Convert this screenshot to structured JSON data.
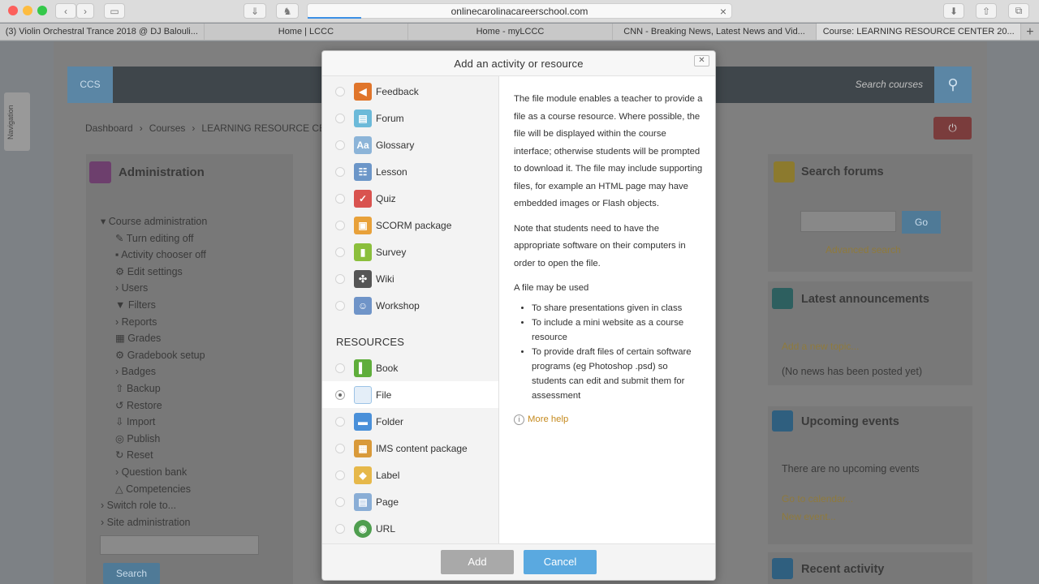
{
  "browser": {
    "url": "onlinecarolinacareerschool.com",
    "tabs": [
      {
        "label": "(3) Violin Orchestral Trance 2018 @ DJ Balouli..."
      },
      {
        "label": "Home | LCCC"
      },
      {
        "label": "Home - myLCCC"
      },
      {
        "label": "CNN - Breaking News, Latest News and Vid..."
      },
      {
        "label": "Course: LEARNING RESOURCE CENTER 20..."
      }
    ]
  },
  "background": {
    "logo": "CCS",
    "search_placeholder": "Search courses",
    "breadcrumb": [
      "Dashboard",
      "Courses",
      "LEARNING RESOURCE CENTER"
    ],
    "nav_tab": "Navigation",
    "admin": {
      "title": "Administration",
      "items": [
        "Course administration",
        "Turn editing off",
        "Activity chooser off",
        "Edit settings",
        "Users",
        "Filters",
        "Reports",
        "Grades",
        "Gradebook setup",
        "Badges",
        "Backup",
        "Restore",
        "Import",
        "Publish",
        "Reset",
        "Question bank",
        "Competencies",
        "Switch role to...",
        "Site administration"
      ],
      "search_button": "Search"
    },
    "search_forums": {
      "title": "Search forums",
      "go": "Go",
      "advanced": "Advanced search"
    },
    "announcements": {
      "title": "Latest announcements",
      "add": "Add a new topic...",
      "empty": "(No news has been posted yet)"
    },
    "events": {
      "title": "Upcoming events",
      "empty": "There are no upcoming events",
      "calendar": "Go to calendar...",
      "new": "New event..."
    },
    "recent": {
      "title": "Recent activity"
    }
  },
  "modal": {
    "title": "Add an activity or resource",
    "close": "✕",
    "activities": [
      {
        "label": "Feedback",
        "icon": "megaphone-icon",
        "color": "#e0752b"
      },
      {
        "label": "Forum",
        "icon": "forum-icon",
        "color": "#6cbad9"
      },
      {
        "label": "Glossary",
        "icon": "glossary-icon",
        "color": "#8cb4d8"
      },
      {
        "label": "Lesson",
        "icon": "lesson-icon",
        "color": "#6c96c8"
      },
      {
        "label": "Quiz",
        "icon": "quiz-icon",
        "color": "#d9534f"
      },
      {
        "label": "SCORM package",
        "icon": "scorm-icon",
        "color": "#e8a13a"
      },
      {
        "label": "Survey",
        "icon": "survey-icon",
        "color": "#8bbf3c"
      },
      {
        "label": "Wiki",
        "icon": "wiki-icon",
        "color": "#555555"
      },
      {
        "label": "Workshop",
        "icon": "workshop-icon",
        "color": "#6f94c8"
      }
    ],
    "resources_heading": "RESOURCES",
    "resources": [
      {
        "label": "Book",
        "icon": "book-icon",
        "color": "#5fae3b"
      },
      {
        "label": "File",
        "icon": "file-icon",
        "color": "#9cc3e6"
      },
      {
        "label": "Folder",
        "icon": "folder-icon",
        "color": "#4a90d9"
      },
      {
        "label": "IMS content package",
        "icon": "ims-package-icon",
        "color": "#d99a3a"
      },
      {
        "label": "Label",
        "icon": "label-icon",
        "color": "#e6b84a"
      },
      {
        "label": "Page",
        "icon": "page-icon",
        "color": "#8aaed6"
      },
      {
        "label": "URL",
        "icon": "url-globe-icon",
        "color": "#4f9e4f"
      }
    ],
    "selected": "File",
    "description": {
      "p1": "The file module enables a teacher to provide a file as a course resource. Where possible, the file will be displayed within the course interface; otherwise students will be prompted to download it. The file may include supporting files, for example an HTML page may have embedded images or Flash objects.",
      "p2": "Note that students need to have the appropriate software on their computers in order to open the file.",
      "p3": "A file may be used",
      "uses": [
        "To share presentations given in class",
        "To include a mini website as a course resource",
        "To provide draft files of certain software programs (eg Photoshop .psd) so students can edit and submit them for assessment"
      ],
      "more_help": "More help"
    },
    "add_label": "Add",
    "cancel_label": "Cancel"
  }
}
